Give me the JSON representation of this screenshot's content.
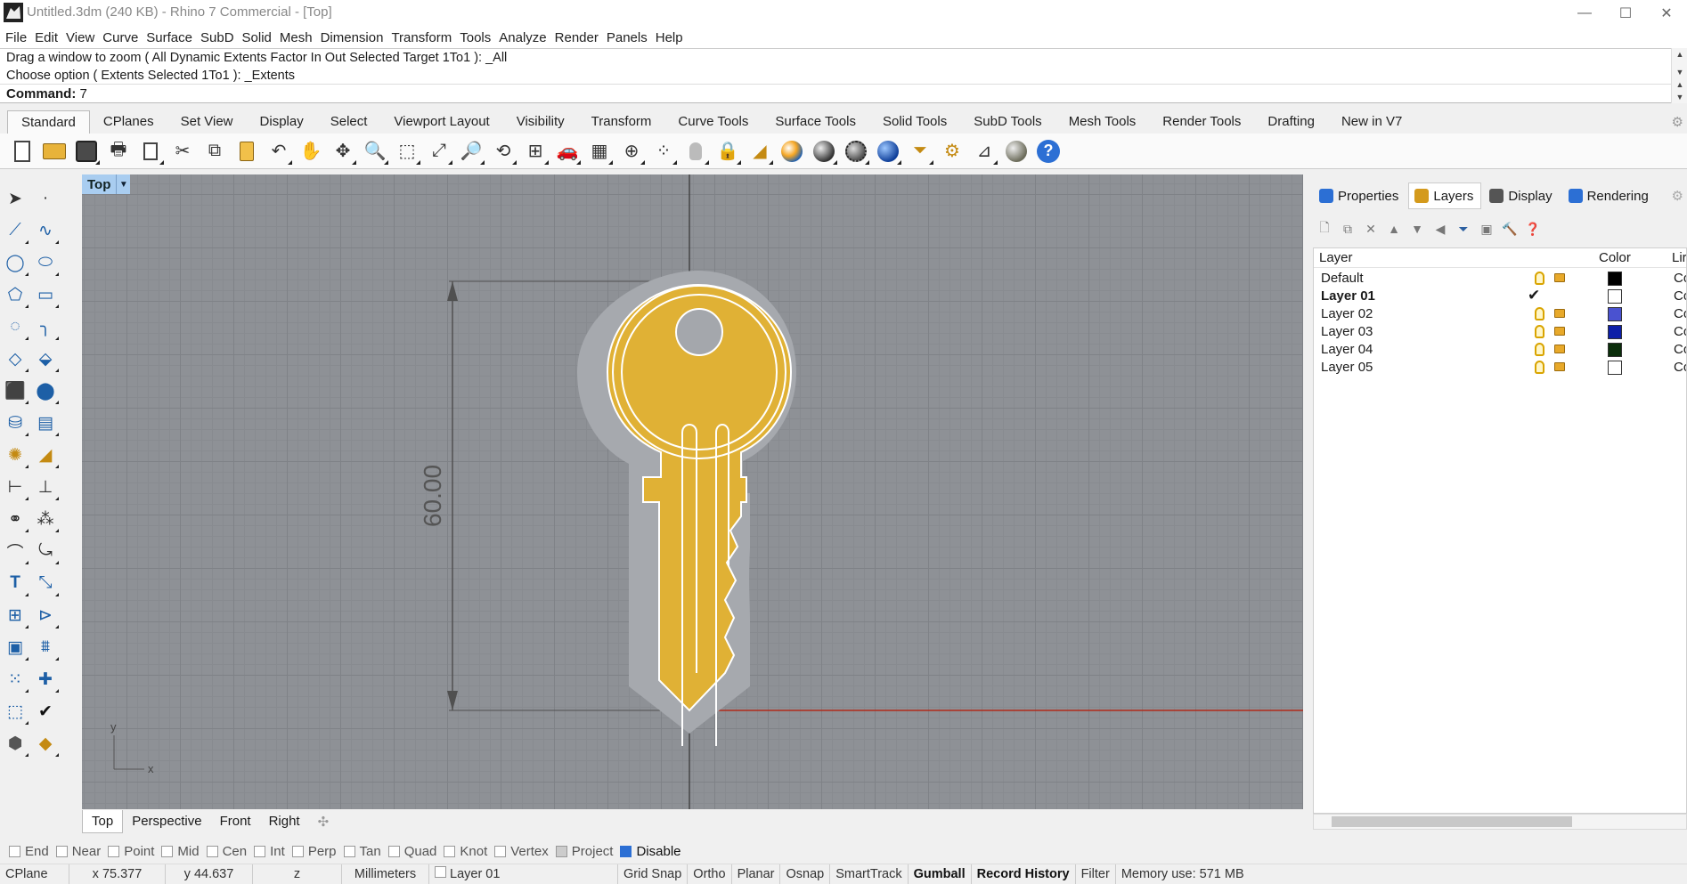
{
  "window": {
    "title": "Untitled.3dm (240 KB) - Rhino 7 Commercial - [Top]",
    "controls": {
      "minimize": "—",
      "maximize": "☐",
      "close": "✕"
    }
  },
  "menu": [
    "File",
    "Edit",
    "View",
    "Curve",
    "Surface",
    "SubD",
    "Solid",
    "Mesh",
    "Dimension",
    "Transform",
    "Tools",
    "Analyze",
    "Render",
    "Panels",
    "Help"
  ],
  "command": {
    "history": [
      "Drag a window to zoom ( All  Dynamic  Extents  Factor  In  Out  Selected  Target  1To1 ): _All",
      "Choose option ( Extents  Selected  1To1 ): _Extents"
    ],
    "label": "Command:",
    "value": "7"
  },
  "toolbar_tabs": [
    "Standard",
    "CPlanes",
    "Set View",
    "Display",
    "Select",
    "Viewport Layout",
    "Visibility",
    "Transform",
    "Curve Tools",
    "Surface Tools",
    "Solid Tools",
    "SubD Tools",
    "Mesh Tools",
    "Render Tools",
    "Drafting",
    "New in V7"
  ],
  "active_toolbar_tab": "Standard",
  "viewport": {
    "name": "Top",
    "dimension_text": "60.00",
    "axis_y": "y",
    "axis_x": "x",
    "key_color": "#e0b135"
  },
  "viewport_tabs": [
    "Top",
    "Perspective",
    "Front",
    "Right"
  ],
  "active_viewport_tab": "Top",
  "panel": {
    "tabs": [
      "Properties",
      "Layers",
      "Display",
      "Rendering"
    ],
    "active_tab": "Layers",
    "columns": {
      "layer": "Layer",
      "color": "Color",
      "linetype": "Lir"
    },
    "layers": [
      {
        "name": "Default",
        "current": false,
        "color": "#000000",
        "linetype": "Co"
      },
      {
        "name": "Layer 01",
        "current": true,
        "color": "#ffffff",
        "linetype": "Co"
      },
      {
        "name": "Layer 02",
        "current": false,
        "color": "#4a52d0",
        "linetype": "Co"
      },
      {
        "name": "Layer 03",
        "current": false,
        "color": "#0d1fa8",
        "linetype": "Co"
      },
      {
        "name": "Layer 04",
        "current": false,
        "color": "#0b2e0b",
        "linetype": "Co"
      },
      {
        "name": "Layer 05",
        "current": false,
        "color": "#ffffff",
        "linetype": "Co"
      }
    ]
  },
  "osnaps": [
    {
      "label": "End",
      "checked": false
    },
    {
      "label": "Near",
      "checked": false
    },
    {
      "label": "Point",
      "checked": false
    },
    {
      "label": "Mid",
      "checked": false
    },
    {
      "label": "Cen",
      "checked": false
    },
    {
      "label": "Int",
      "checked": false
    },
    {
      "label": "Perp",
      "checked": false
    },
    {
      "label": "Tan",
      "checked": false
    },
    {
      "label": "Quad",
      "checked": false
    },
    {
      "label": "Knot",
      "checked": false
    },
    {
      "label": "Vertex",
      "checked": false
    },
    {
      "label": "Project",
      "checked": false,
      "disabled": true
    },
    {
      "label": "Disable",
      "checked": true
    }
  ],
  "status": {
    "cplane": "CPlane",
    "x": "x 75.377",
    "y": "y 44.637",
    "z": "z",
    "units": "Millimeters",
    "layer": "Layer 01",
    "grid_snap": "Grid Snap",
    "ortho": "Ortho",
    "planar": "Planar",
    "osnap": "Osnap",
    "smarttrack": "SmartTrack",
    "gumball": "Gumball",
    "record_history": "Record History",
    "filter": "Filter",
    "memory": "Memory use: 571 MB"
  }
}
